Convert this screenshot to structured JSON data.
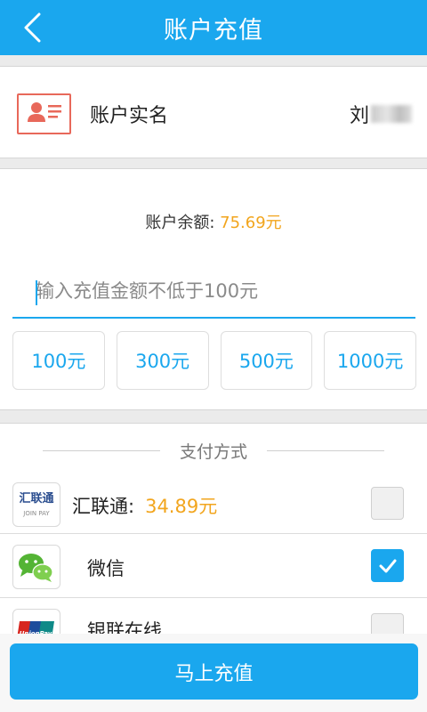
{
  "header": {
    "title": "账户充值",
    "back_icon": "back-chevron-icon"
  },
  "account": {
    "label": "账户实名",
    "name_visible": "刘",
    "icon": "id-card-icon",
    "icon_color": "#e8685a"
  },
  "recharge": {
    "balance_label": "账户余额:",
    "balance_value": "75.69元",
    "input_placeholder": "输入充值金额不低于100元",
    "presets": [
      "100元",
      "300元",
      "500元",
      "1000元"
    ]
  },
  "payment": {
    "section_title": "支付方式",
    "methods": [
      {
        "name": "汇联通:",
        "extra": "34.89元",
        "icon": "huiliantong-logo-icon",
        "checked": false
      },
      {
        "name": "微信",
        "extra": "",
        "icon": "wechat-icon",
        "checked": true
      },
      {
        "name": "银联在线",
        "extra": "",
        "icon": "unionpay-icon",
        "checked": false
      }
    ],
    "icon_texts": {
      "huiliantong_cn": "汇联通",
      "huiliantong_en": "JOIN PAY",
      "unionpay": "UnionPay"
    }
  },
  "submit_label": "马上充值",
  "colors": {
    "accent": "#1aa7ee",
    "amount": "#f2a51d",
    "background": "#ebebeb"
  }
}
